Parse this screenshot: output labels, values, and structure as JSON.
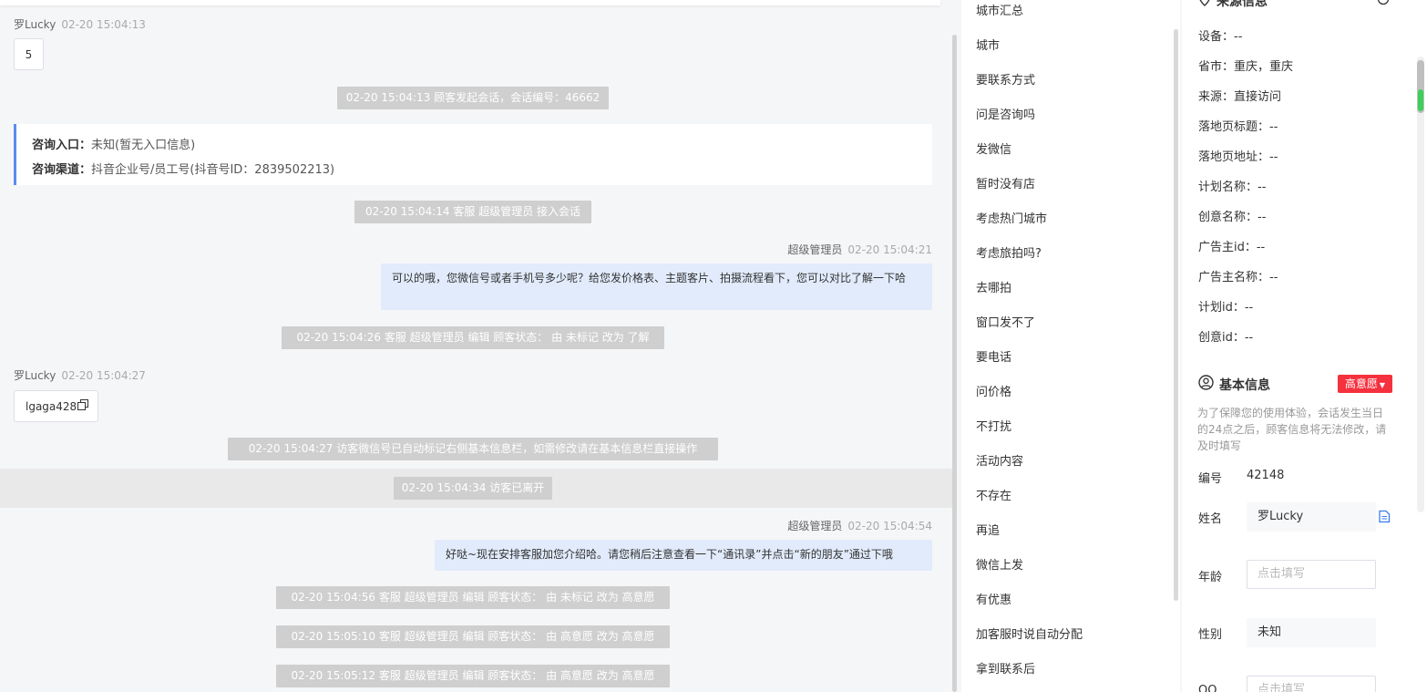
{
  "chat": {
    "msg1": {
      "sender": "罗Lucky",
      "time": "02-20 15:04:13",
      "text": "5"
    },
    "sys1": "02-20 15:04:13 顾客发起会话，会话编号：46662",
    "entry": {
      "entry_label": "咨询入口：",
      "entry_value": "未知(暂无入口信息)",
      "channel_label": "咨询渠道：",
      "channel_value": "抖音企业号/员工号(抖音号ID：2839502213)"
    },
    "sys2": "02-20 15:04:14 客服 超级管理员 接入会话",
    "msg2": {
      "sender": "超级管理员",
      "time": "02-20 15:04:21",
      "text": "可以的哦，您微信号或者手机号多少呢？给您发价格表、主题客片、拍摄流程看下，您可以对比了解一下哈"
    },
    "sys3": "02-20 15:04:26 客服 超级管理员 编辑 顾客状态： 由 未标记 改为 了解",
    "msg3": {
      "sender": "罗Lucky",
      "time": "02-20 15:04:27",
      "text": "lgaga428"
    },
    "sys4": "02-20 15:04:27 访客微信号已自动标记右侧基本信息栏，如需修改请在基本信息栏直接操作",
    "sys5": "02-20 15:04:34 访客已离开",
    "msg4": {
      "sender": "超级管理员",
      "time": "02-20 15:04:54",
      "text": "好哒~现在安排客服加您介绍哈。请您稍后注意查看一下“通讯录”并点击“新的朋友”通过下哦"
    },
    "sys6": "02-20 15:04:56 客服 超级管理员 编辑 顾客状态： 由 未标记 改为 高意愿",
    "sys7": "02-20 15:05:10 客服 超级管理员 编辑 顾客状态： 由 高意愿 改为 高意愿",
    "sys8": "02-20 15:05:12 客服 超级管理员 编辑 顾客状态： 由 高意愿 改为 高意愿"
  },
  "quick_replies": [
    "城市汇总",
    "城市",
    "要联系方式",
    "问是咨询吗",
    "发微信",
    "暂时没有店",
    "考虑热门城市",
    "考虑旅拍吗?",
    "去哪拍",
    "窗口发不了",
    "要电话",
    "问价格",
    "不打扰",
    "活动内容",
    "不存在",
    "再追",
    "微信上发",
    "有优惠",
    "加客服时说自动分配",
    "拿到联系后"
  ],
  "source": {
    "title": "来源信息",
    "rows": [
      "设备：--",
      "省市：重庆，重庆",
      "来源：直接访问",
      "落地页标题：--",
      "落地页地址：--",
      "计划名称：--",
      "创意名称：--",
      "广告主id：--",
      "广告主名称：--",
      "计划id：--",
      "创意id：--"
    ]
  },
  "basic": {
    "title": "基本信息",
    "intent": "高意愿",
    "hint": "为了保障您的使用体验，会话发生当日的24点之后，顾客信息将无法修改，请及时填写",
    "id_label": "编号",
    "id_value": "42148",
    "name_label": "姓名",
    "name_value": "罗Lucky",
    "age_label": "年龄",
    "age_placeholder": "点击填写",
    "gender_label": "性别",
    "gender_value": "未知",
    "qq_label": "QQ",
    "qq_placeholder": "点击填写"
  },
  "colors": {
    "accent_blue": "#5b8def",
    "intent_red": "#f5313d",
    "outgoing_bubble": "#e1ebfb",
    "system_notice": "#cfcfcf"
  }
}
